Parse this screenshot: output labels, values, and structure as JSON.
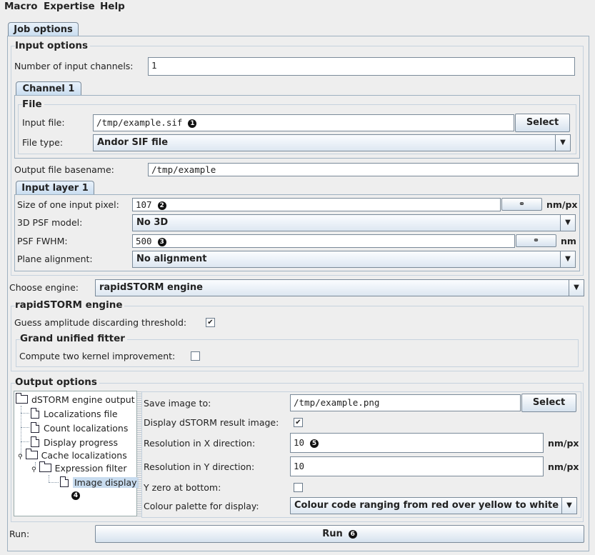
{
  "menu": {
    "macro": "Macro",
    "expertise": "Expertise",
    "help": "Help"
  },
  "tabs": {
    "job_options": "Job options",
    "channel": "Channel 1",
    "input_layer": "Input layer 1"
  },
  "input_options": {
    "title": "Input options",
    "channels_label": "Number of input channels:",
    "channels_value": "1",
    "file_group_title": "File",
    "input_file_label": "Input file:",
    "input_file_value": "/tmp/example.sif",
    "input_file_badge": "1",
    "select_label": "Select",
    "file_type_label": "File type:",
    "file_type_value": "Andor SIF file",
    "output_basename_label": "Output file basename:",
    "output_basename_value": "/tmp/example",
    "pixel_size_label": "Size of one input pixel:",
    "pixel_size_value": "107",
    "pixel_size_badge": "2",
    "pixel_unit": "nm/px",
    "psf_model_label": "3D PSF model:",
    "psf_model_value": "No 3D",
    "psf_fwhm_label": "PSF FWHM:",
    "psf_fwhm_value": "500",
    "psf_fwhm_badge": "3",
    "fwhm_unit": "nm",
    "alignment_label": "Plane alignment:",
    "alignment_value": "No alignment",
    "link_icon": "chain-link-icon"
  },
  "engine": {
    "choose_label": "Choose engine:",
    "choose_value": "rapidSTORM engine",
    "group_title": "rapidSTORM engine",
    "guess_label": "Guess amplitude discarding threshold:",
    "guess_checked": true,
    "fitter_title": "Grand unified fitter",
    "kernel_label": "Compute two kernel improvement:",
    "kernel_checked": false
  },
  "output": {
    "title": "Output options",
    "tree": {
      "root": "dSTORM engine output",
      "localizations_file": "Localizations file",
      "count_localizations": "Count localizations",
      "display_progress": "Display progress",
      "cache_localizations": "Cache localizations",
      "expression_filter": "Expression filter",
      "image_display": "Image display",
      "image_display_badge": "4"
    },
    "save_label": "Save image to:",
    "save_value": "/tmp/example.png",
    "select_label": "Select",
    "display_label": "Display dSTORM result image:",
    "display_checked": true,
    "res_x_label": "Resolution in X direction:",
    "res_x_value": "10",
    "res_x_badge": "5",
    "res_y_label": "Resolution in Y direction:",
    "res_y_value": "10",
    "res_unit": "nm/px",
    "yzero_label": "Y zero at bottom:",
    "yzero_checked": false,
    "palette_label": "Colour palette for display:",
    "palette_value": "Colour code ranging from red over yellow to white"
  },
  "run": {
    "label": "Run:",
    "button": "Run",
    "badge": "6"
  }
}
